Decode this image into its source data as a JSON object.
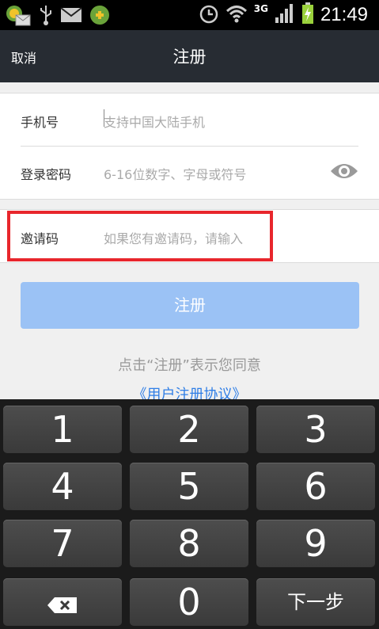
{
  "statusbar": {
    "time": "21:49",
    "network": "3G"
  },
  "header": {
    "cancel": "取消",
    "title": "注册"
  },
  "form": {
    "phone_label": "手机号",
    "phone_placeholder": "支持中国大陆手机",
    "password_label": "登录密码",
    "password_placeholder": "6-16位数字、字母或符号",
    "invite_label": "邀请码",
    "invite_placeholder": "如果您有邀请码，请输入"
  },
  "register_button": "注册",
  "agreement_text": "点击“注册”表示您同意",
  "agreement_link": "《用户注册协议》",
  "keyboard": {
    "keys": [
      "1",
      "2",
      "3",
      "4",
      "5",
      "6",
      "7",
      "8",
      "9"
    ],
    "zero": "0",
    "next": "下一步"
  },
  "colors": {
    "accent": "#9bc2f5",
    "highlight": "#e8262c",
    "link": "#2f7ee6",
    "titlebar": "#272c33"
  }
}
